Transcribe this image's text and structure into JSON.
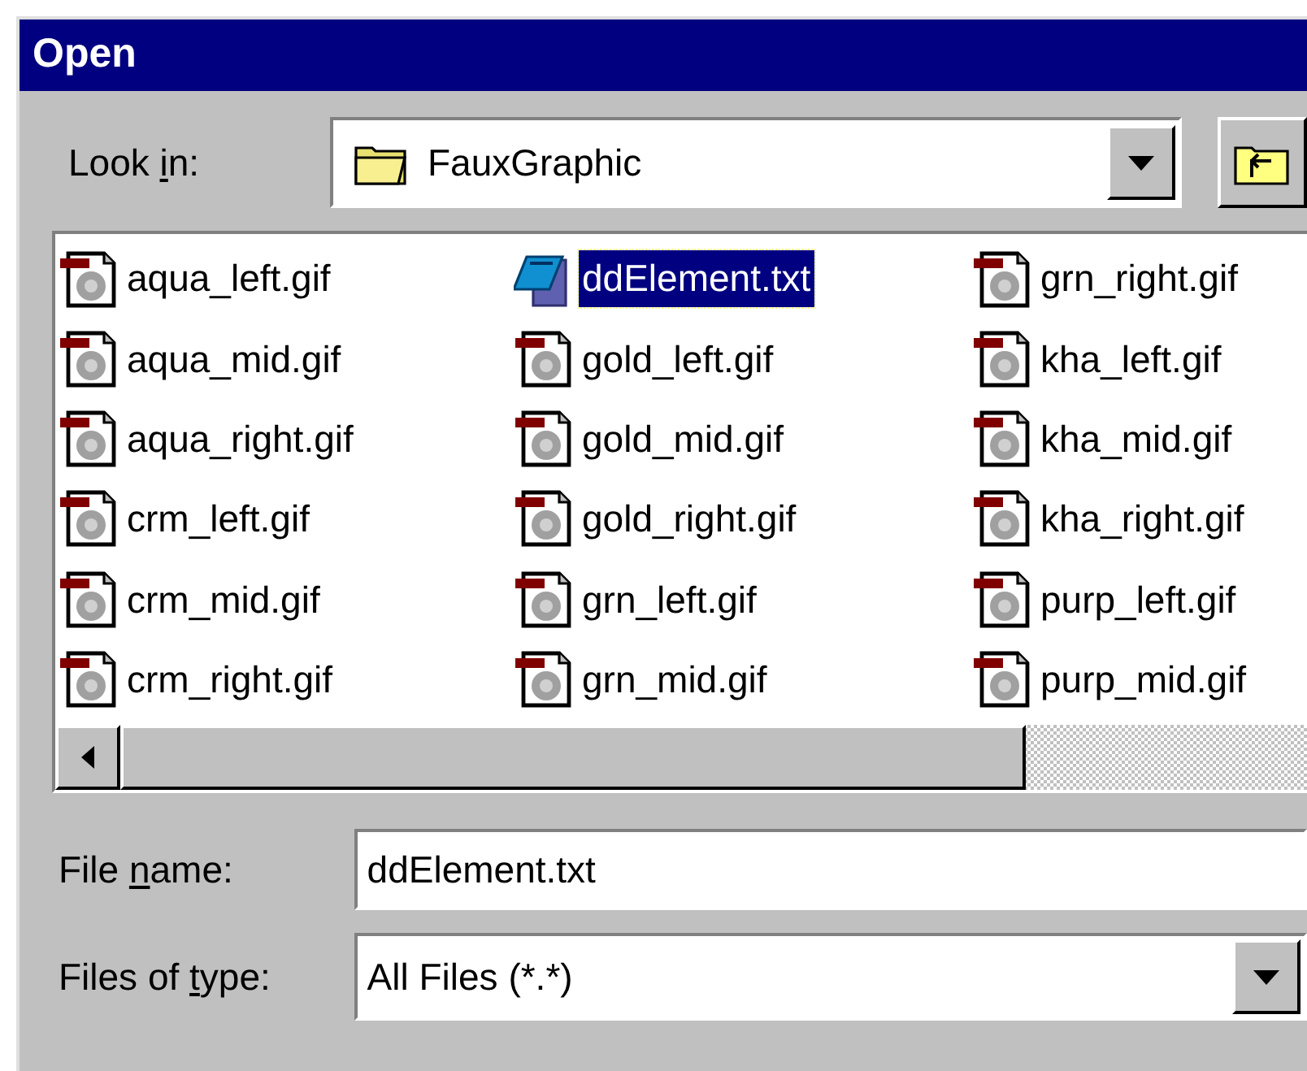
{
  "window": {
    "title": "Open"
  },
  "look_in": {
    "label": {
      "before": "Look ",
      "key": "i",
      "after": "n:"
    },
    "value": "FauxGraphic"
  },
  "files": [
    {
      "name": "aqua_left.gif",
      "kind": "gif",
      "selected": false
    },
    {
      "name": "aqua_mid.gif",
      "kind": "gif",
      "selected": false
    },
    {
      "name": "aqua_right.gif",
      "kind": "gif",
      "selected": false
    },
    {
      "name": "crm_left.gif",
      "kind": "gif",
      "selected": false
    },
    {
      "name": "crm_mid.gif",
      "kind": "gif",
      "selected": false
    },
    {
      "name": "crm_right.gif",
      "kind": "gif",
      "selected": false
    },
    {
      "name": "ddElement.txt",
      "kind": "txt",
      "selected": true
    },
    {
      "name": "gold_left.gif",
      "kind": "gif",
      "selected": false
    },
    {
      "name": "gold_mid.gif",
      "kind": "gif",
      "selected": false
    },
    {
      "name": "gold_right.gif",
      "kind": "gif",
      "selected": false
    },
    {
      "name": "grn_left.gif",
      "kind": "gif",
      "selected": false
    },
    {
      "name": "grn_mid.gif",
      "kind": "gif",
      "selected": false
    },
    {
      "name": "grn_right.gif",
      "kind": "gif",
      "selected": false
    },
    {
      "name": "kha_left.gif",
      "kind": "gif",
      "selected": false
    },
    {
      "name": "kha_mid.gif",
      "kind": "gif",
      "selected": false
    },
    {
      "name": "kha_right.gif",
      "kind": "gif",
      "selected": false
    },
    {
      "name": "purp_left.gif",
      "kind": "gif",
      "selected": false
    },
    {
      "name": "purp_mid.gif",
      "kind": "gif",
      "selected": false
    }
  ],
  "file_name": {
    "label": {
      "before": "File ",
      "key": "n",
      "after": "ame:"
    },
    "value": "ddElement.txt"
  },
  "file_type": {
    "label": {
      "before": "Files of ",
      "key": "t",
      "after": "ype:"
    },
    "value": "All Files (*.*)"
  }
}
